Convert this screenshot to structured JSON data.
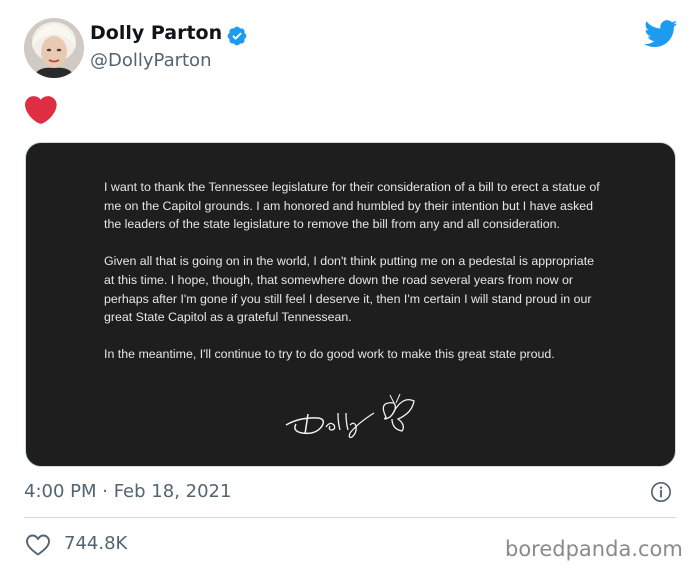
{
  "author": {
    "name": "Dolly Parton",
    "handle": "@DollyParton",
    "verified_icon": "verified-badge-icon",
    "avatar": "avatar"
  },
  "tweet": {
    "emoji": "heart-emoji",
    "letter": {
      "paragraphs": [
        "I want to thank the Tennessee legislature for their consideration of a bill to erect a statue of me on the Capitol grounds. I am honored and humbled by their intention but I have asked the leaders of the state legislature to remove the bill from any and all consideration.",
        "Given all that is going on in the world, I don't think putting me on a pedestal is appropriate at this time. I hope, though, that somewhere down the road several years from now or perhaps after I'm gone if you still feel I deserve it, then I'm certain I will stand proud in our great State Capitol as a grateful Tennessean.",
        "In the meantime, I'll continue to try to do good work to make this great state proud."
      ],
      "signature": "Dolly"
    },
    "timestamp": "4:00 PM · Feb 18, 2021",
    "likes": "744.8K"
  },
  "watermark": "boredpanda.com",
  "colors": {
    "twitter_blue": "#1d9bf0",
    "heart_red": "#dd2e44",
    "secondary_text": "#536471"
  }
}
